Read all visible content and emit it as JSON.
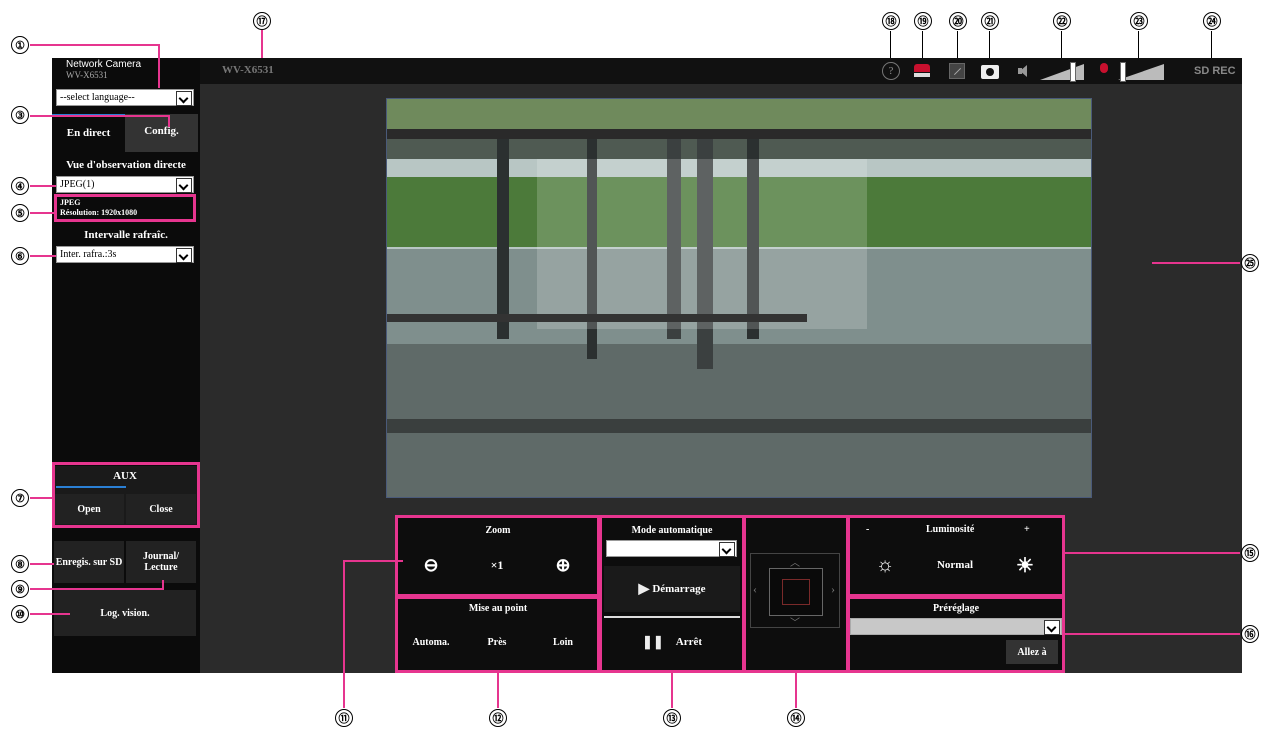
{
  "camera": {
    "title": "Network Camera",
    "model": "WV-X6531",
    "header_model": "WV-X6531"
  },
  "language": {
    "value": "--select language--"
  },
  "tabs": {
    "live": "En direct",
    "setup": "Config."
  },
  "stream": {
    "heading": "Vue d'observation directe",
    "value": "JPEG(1)",
    "info_line1": "JPEG",
    "info_line2": "Résolution: 1920x1080"
  },
  "refresh": {
    "heading": "Intervalle rafraîc.",
    "value": "Inter. rafra.:3s"
  },
  "aux": {
    "title": "AUX",
    "open": "Open",
    "close": "Close"
  },
  "sd": {
    "record": "Enregis. sur SD",
    "log": "Journal/\nLecture",
    "log_line1": "Journal/",
    "log_line2": "Lecture"
  },
  "log_view": "Log. vision.",
  "topbar": {
    "sd_rec": "SD REC",
    "help_icon": "help-icon"
  },
  "zoom": {
    "title": "Zoom",
    "x1": "×1"
  },
  "focus": {
    "title": "Mise au point",
    "auto": "Automa.",
    "near": "Près",
    "far": "Loin"
  },
  "auto_mode": {
    "title": "Mode automatique",
    "value": "",
    "start": "Démarrage",
    "stop": "Arrêt"
  },
  "brightness": {
    "title": "Luminosité",
    "minus": "-",
    "plus": "+",
    "normal": "Normal"
  },
  "preset": {
    "title": "Préréglage",
    "value": "",
    "go": "Allez à"
  },
  "callouts": [
    "①",
    "②",
    "③",
    "④",
    "⑤",
    "⑥",
    "⑦",
    "⑧",
    "⑨",
    "⑩",
    "⑪",
    "⑫",
    "⑬",
    "⑭",
    "⑮",
    "⑯",
    "⑰",
    "⑱",
    "⑲",
    "⑳",
    "㉑",
    "㉒",
    "㉓",
    "㉔",
    "㉕"
  ],
  "colors": {
    "accent": "#e6358f",
    "panel_bg": "#0d0d0d",
    "app_bg": "#2b2b2b",
    "tab_line": "#2a7fd4"
  }
}
